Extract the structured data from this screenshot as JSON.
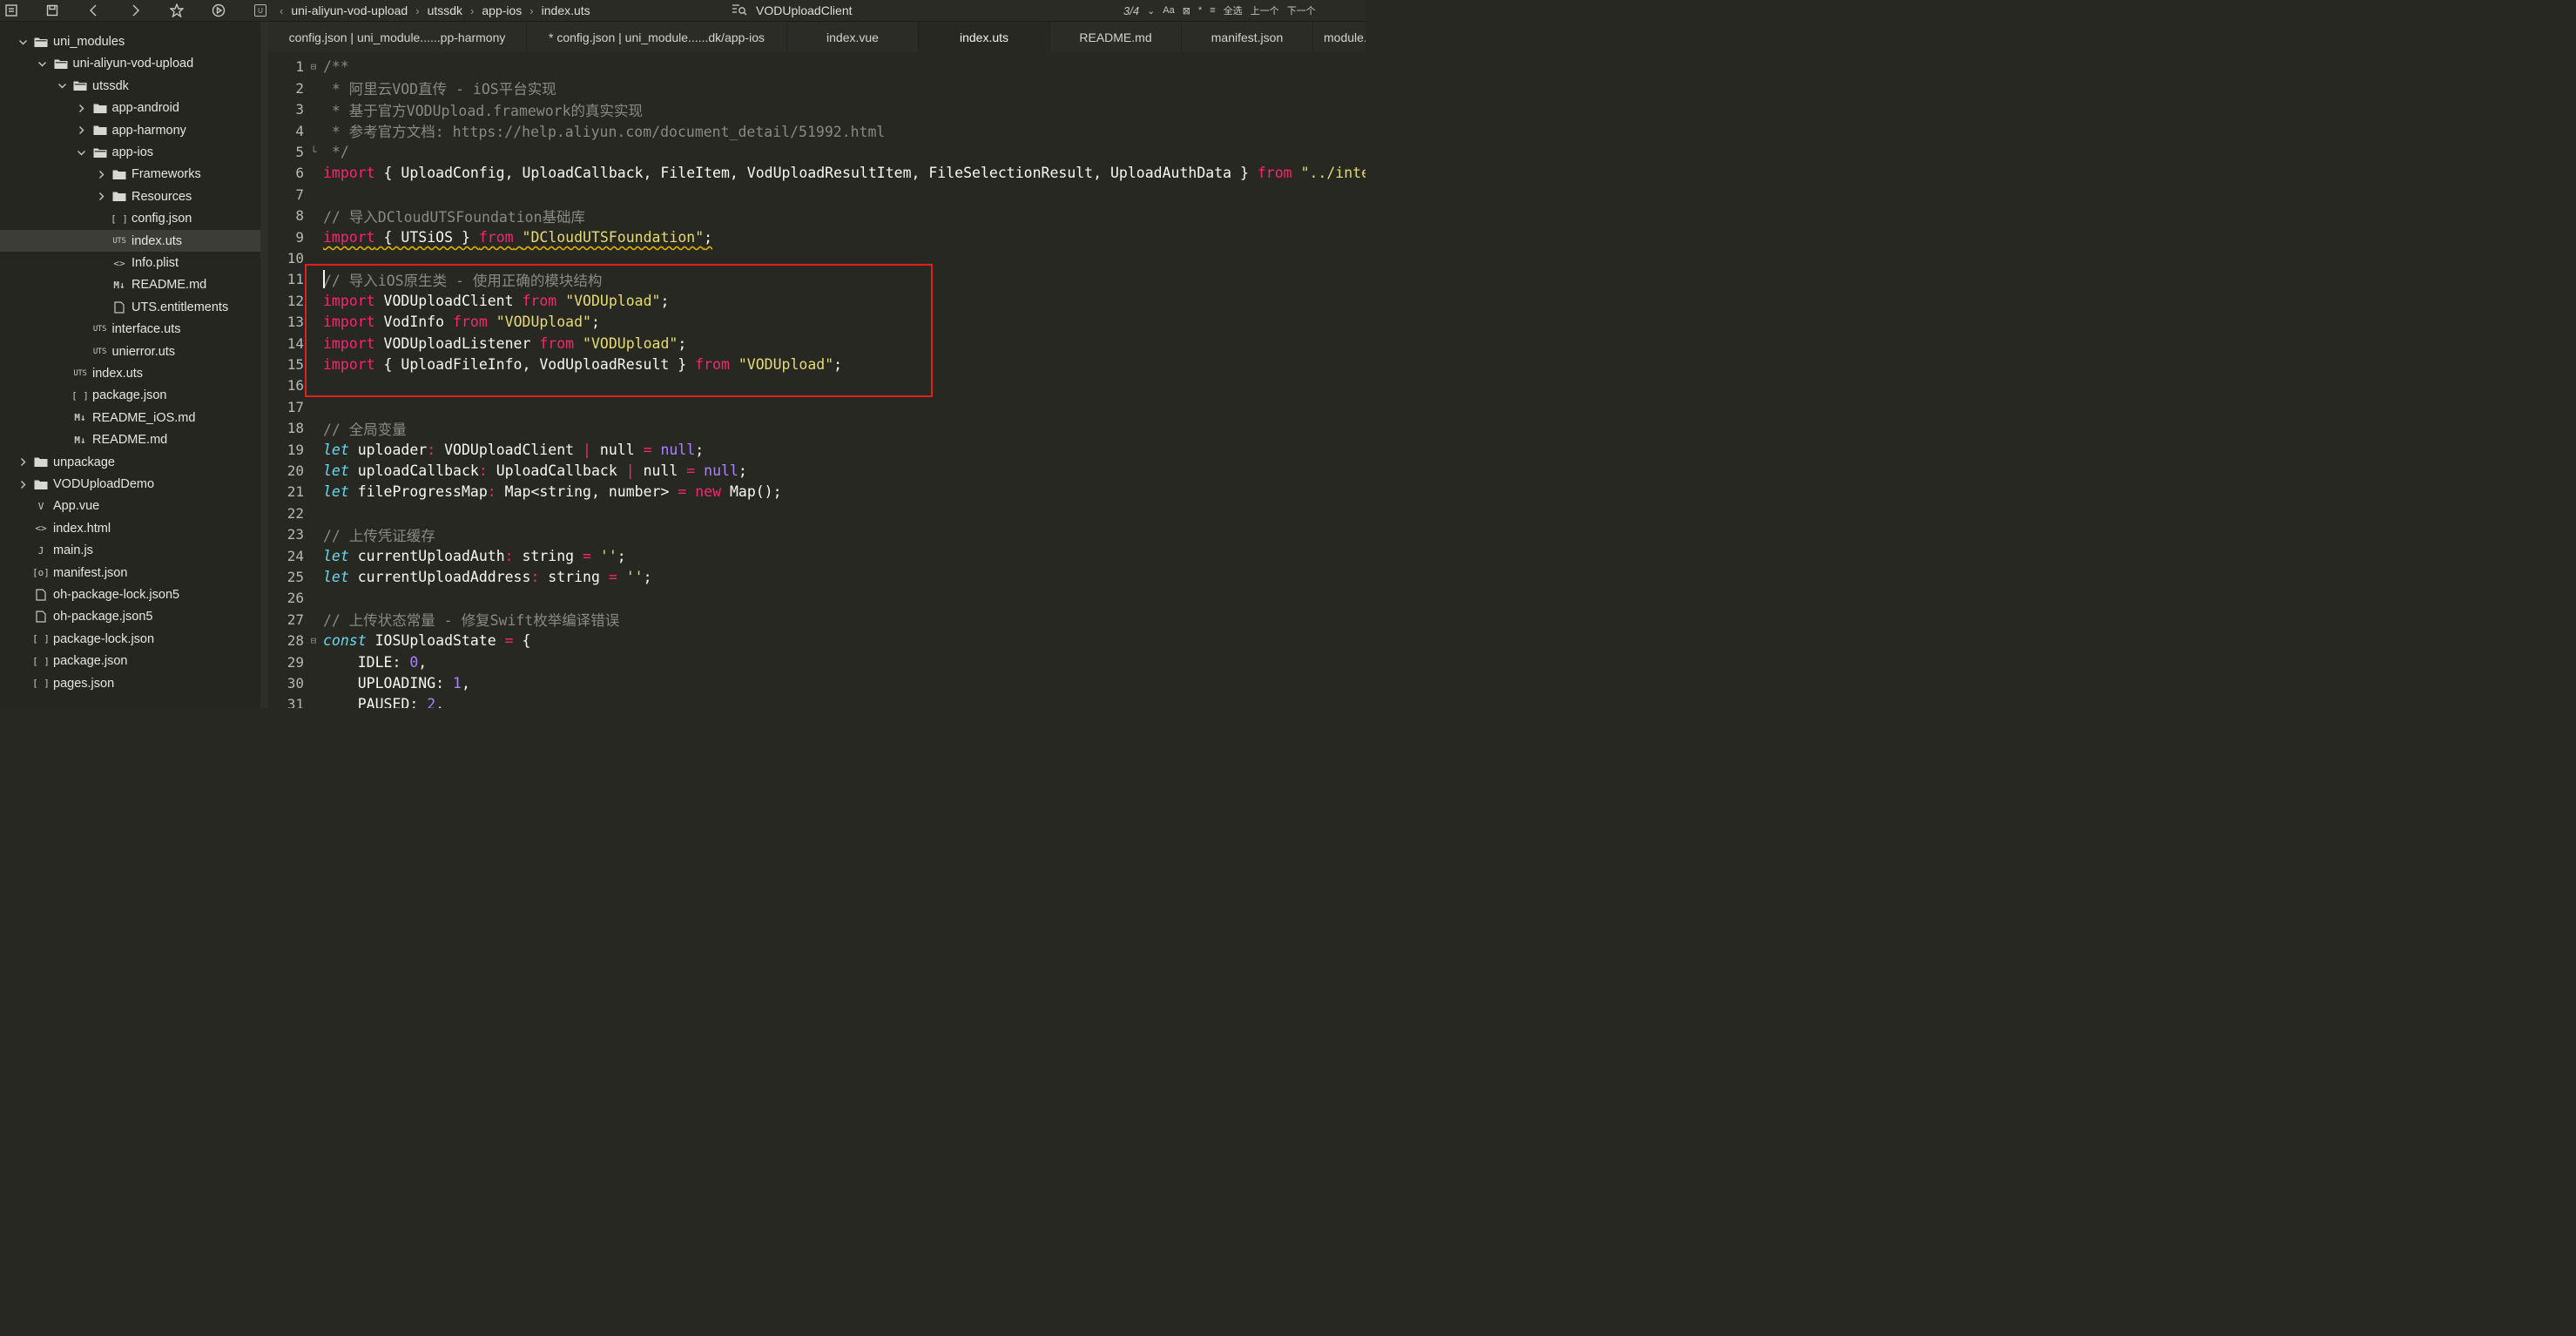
{
  "topbar": {
    "breadcrumbs": [
      "uni-aliyun-vod-upload",
      "utssdk",
      "app-ios",
      "index.uts"
    ],
    "symbol_name": "VODUploadClient",
    "match_count": "3/4",
    "right_controls": [
      "Aa",
      "全选",
      "上一个",
      "下一个"
    ]
  },
  "sidebar": {
    "items": [
      {
        "label": "uni_modules",
        "depth": 0,
        "kind": "folder",
        "expanded": true,
        "icon": "folder-icon"
      },
      {
        "label": "uni-aliyun-vod-upload",
        "depth": 1,
        "kind": "folder",
        "expanded": true,
        "icon": "folder-icon"
      },
      {
        "label": "utssdk",
        "depth": 2,
        "kind": "folder",
        "expanded": true,
        "icon": "folder-icon"
      },
      {
        "label": "app-android",
        "depth": 3,
        "kind": "folder",
        "expanded": false,
        "icon": "folder-icon"
      },
      {
        "label": "app-harmony",
        "depth": 3,
        "kind": "folder",
        "expanded": false,
        "icon": "folder-icon"
      },
      {
        "label": "app-ios",
        "depth": 3,
        "kind": "folder",
        "expanded": true,
        "icon": "folder-icon"
      },
      {
        "label": "Frameworks",
        "depth": 4,
        "kind": "folder",
        "expanded": false,
        "icon": "folder-icon"
      },
      {
        "label": "Resources",
        "depth": 4,
        "kind": "folder",
        "expanded": false,
        "icon": "folder-icon"
      },
      {
        "label": "config.json",
        "depth": 4,
        "kind": "file",
        "icon": "json-icon",
        "glyph": "[ ]"
      },
      {
        "label": "index.uts",
        "depth": 4,
        "kind": "file",
        "icon": "uts-icon",
        "glyph": "UTS",
        "selected": true
      },
      {
        "label": "Info.plist",
        "depth": 4,
        "kind": "file",
        "icon": "code-icon",
        "glyph": "<>"
      },
      {
        "label": "README.md",
        "depth": 4,
        "kind": "file",
        "icon": "markdown-icon",
        "glyph": "M↓"
      },
      {
        "label": "UTS.entitlements",
        "depth": 4,
        "kind": "file",
        "icon": "file-icon"
      },
      {
        "label": "interface.uts",
        "depth": 3,
        "kind": "file",
        "icon": "uts-icon",
        "glyph": "UTS"
      },
      {
        "label": "unierror.uts",
        "depth": 3,
        "kind": "file",
        "icon": "uts-icon",
        "glyph": "UTS"
      },
      {
        "label": "index.uts",
        "depth": 2,
        "kind": "file",
        "icon": "uts-icon",
        "glyph": "UTS"
      },
      {
        "label": "package.json",
        "depth": 2,
        "kind": "file",
        "icon": "json-icon",
        "glyph": "[ ]"
      },
      {
        "label": "README_iOS.md",
        "depth": 2,
        "kind": "file",
        "icon": "markdown-icon",
        "glyph": "M↓"
      },
      {
        "label": "README.md",
        "depth": 2,
        "kind": "file",
        "icon": "markdown-icon",
        "glyph": "M↓"
      },
      {
        "label": "unpackage",
        "depth": 0,
        "kind": "folder",
        "expanded": false,
        "icon": "folder-icon"
      },
      {
        "label": "VODUploadDemo",
        "depth": 0,
        "kind": "folder",
        "expanded": false,
        "icon": "folder-icon"
      },
      {
        "label": "App.vue",
        "depth": 0,
        "kind": "file",
        "icon": "vue-icon",
        "glyph": "V"
      },
      {
        "label": "index.html",
        "depth": 0,
        "kind": "file",
        "icon": "code-icon",
        "glyph": "<>"
      },
      {
        "label": "main.js",
        "depth": 0,
        "kind": "file",
        "icon": "js-icon",
        "glyph": "J"
      },
      {
        "label": "manifest.json",
        "depth": 0,
        "kind": "file",
        "icon": "settings-file-icon",
        "glyph": "[o]"
      },
      {
        "label": "oh-package-lock.json5",
        "depth": 0,
        "kind": "file",
        "icon": "file-icon"
      },
      {
        "label": "oh-package.json5",
        "depth": 0,
        "kind": "file",
        "icon": "file-icon"
      },
      {
        "label": "package-lock.json",
        "depth": 0,
        "kind": "file",
        "icon": "json-icon",
        "glyph": "[ ]"
      },
      {
        "label": "package.json",
        "depth": 0,
        "kind": "file",
        "icon": "json-icon",
        "glyph": "[ ]"
      },
      {
        "label": "pages.json",
        "depth": 0,
        "kind": "file",
        "icon": "json-icon",
        "glyph": "[ ]"
      }
    ]
  },
  "tabs": [
    {
      "label": "config.json | uni_module......pp-harmony",
      "active": false
    },
    {
      "label": "* config.json | uni_module......dk/app-ios",
      "active": false
    },
    {
      "label": "index.vue",
      "active": false
    },
    {
      "label": "index.uts",
      "active": true
    },
    {
      "label": "README.md",
      "active": false
    },
    {
      "label": "manifest.json",
      "active": false
    },
    {
      "label": "module.m",
      "active": false
    }
  ],
  "editor": {
    "lines": [
      {
        "n": "1",
        "fold": "⊟",
        "tokens": [
          [
            "c",
            "/**"
          ]
        ]
      },
      {
        "n": "2",
        "tokens": [
          [
            "c",
            " * 阿里云VOD直传 - iOS平台实现"
          ]
        ]
      },
      {
        "n": "3",
        "tokens": [
          [
            "c",
            " * 基于官方VODUpload.framework的真实实现"
          ]
        ]
      },
      {
        "n": "4",
        "tokens": [
          [
            "c",
            " * 参考官方文档: https://help.aliyun.com/document_detail/51992.html"
          ]
        ]
      },
      {
        "n": "5",
        "fold": "└",
        "tokens": [
          [
            "c",
            " */"
          ]
        ]
      },
      {
        "n": "6",
        "tokens": [
          [
            "k",
            "import"
          ],
          [
            "p",
            " { UploadConfig, UploadCallback, FileItem, VodUploadResultItem, FileSelectionResult, UploadAuthData } "
          ],
          [
            "k",
            "from"
          ],
          [
            "p",
            " "
          ],
          [
            "s",
            "\"../interface.uts\""
          ],
          [
            "p",
            ";"
          ]
        ]
      },
      {
        "n": "7",
        "tokens": []
      },
      {
        "n": "8",
        "tokens": [
          [
            "c",
            "// 导入DCloudUTSFoundation基础库"
          ]
        ]
      },
      {
        "n": "9",
        "squiggle": true,
        "tokens": [
          [
            "k",
            "import"
          ],
          [
            "p",
            " { UTSiOS } "
          ],
          [
            "k",
            "from"
          ],
          [
            "p",
            " "
          ],
          [
            "s",
            "\"DCloudUTSFoundation\""
          ],
          [
            "p",
            ";"
          ]
        ]
      },
      {
        "n": "10",
        "tokens": []
      },
      {
        "n": "11",
        "tokens": [
          [
            "c",
            "// 导入iOS原生类 - 使用正确的模块结构"
          ]
        ]
      },
      {
        "n": "12",
        "tokens": [
          [
            "k",
            "import"
          ],
          [
            "p",
            " VODUploadClient "
          ],
          [
            "k",
            "from"
          ],
          [
            "p",
            " "
          ],
          [
            "s",
            "\"VODUpload\""
          ],
          [
            "p",
            ";"
          ]
        ]
      },
      {
        "n": "13",
        "tokens": [
          [
            "k",
            "import"
          ],
          [
            "p",
            " VodInfo "
          ],
          [
            "k",
            "from"
          ],
          [
            "p",
            " "
          ],
          [
            "s",
            "\"VODUpload\""
          ],
          [
            "p",
            ";"
          ]
        ]
      },
      {
        "n": "14",
        "tokens": [
          [
            "k",
            "import"
          ],
          [
            "p",
            " VODUploadListener "
          ],
          [
            "k",
            "from"
          ],
          [
            "p",
            " "
          ],
          [
            "s",
            "\"VODUpload\""
          ],
          [
            "p",
            ";"
          ]
        ]
      },
      {
        "n": "15",
        "tokens": [
          [
            "k",
            "import"
          ],
          [
            "p",
            " { UploadFileInfo, VodUploadResult } "
          ],
          [
            "k",
            "from"
          ],
          [
            "p",
            " "
          ],
          [
            "s",
            "\"VODUpload\""
          ],
          [
            "p",
            ";"
          ]
        ]
      },
      {
        "n": "16",
        "tokens": []
      },
      {
        "n": "17",
        "tokens": []
      },
      {
        "n": "18",
        "tokens": [
          [
            "c",
            "// 全局变量"
          ]
        ]
      },
      {
        "n": "19",
        "tokens": [
          [
            "i",
            "let"
          ],
          [
            "p",
            " uploader"
          ],
          [
            "k",
            ":"
          ],
          [
            "p",
            " VODUploadClient "
          ],
          [
            "k",
            "|"
          ],
          [
            "p",
            " null "
          ],
          [
            "k",
            "="
          ],
          [
            "p",
            " "
          ],
          [
            "n",
            "null"
          ],
          [
            "p",
            ";"
          ]
        ]
      },
      {
        "n": "20",
        "tokens": [
          [
            "i",
            "let"
          ],
          [
            "p",
            " uploadCallback"
          ],
          [
            "k",
            ":"
          ],
          [
            "p",
            " UploadCallback "
          ],
          [
            "k",
            "|"
          ],
          [
            "p",
            " null "
          ],
          [
            "k",
            "="
          ],
          [
            "p",
            " "
          ],
          [
            "n",
            "null"
          ],
          [
            "p",
            ";"
          ]
        ]
      },
      {
        "n": "21",
        "tokens": [
          [
            "i",
            "let"
          ],
          [
            "p",
            " fileProgressMap"
          ],
          [
            "k",
            ":"
          ],
          [
            "p",
            " Map<string, number> "
          ],
          [
            "k",
            "="
          ],
          [
            "p",
            " "
          ],
          [
            "k",
            "new"
          ],
          [
            "p",
            " Map();"
          ]
        ]
      },
      {
        "n": "22",
        "tokens": []
      },
      {
        "n": "23",
        "tokens": [
          [
            "c",
            "// 上传凭证缓存"
          ]
        ]
      },
      {
        "n": "24",
        "tokens": [
          [
            "i",
            "let"
          ],
          [
            "p",
            " currentUploadAuth"
          ],
          [
            "k",
            ":"
          ],
          [
            "p",
            " string "
          ],
          [
            "k",
            "="
          ],
          [
            "p",
            " "
          ],
          [
            "s",
            "''"
          ],
          [
            "p",
            ";"
          ]
        ]
      },
      {
        "n": "25",
        "tokens": [
          [
            "i",
            "let"
          ],
          [
            "p",
            " currentUploadAddress"
          ],
          [
            "k",
            ":"
          ],
          [
            "p",
            " string "
          ],
          [
            "k",
            "="
          ],
          [
            "p",
            " "
          ],
          [
            "s",
            "''"
          ],
          [
            "p",
            ";"
          ]
        ]
      },
      {
        "n": "26",
        "tokens": []
      },
      {
        "n": "27",
        "tokens": [
          [
            "c",
            "// 上传状态常量 - 修复Swift枚举编译错误"
          ]
        ]
      },
      {
        "n": "28",
        "fold": "⊟",
        "tokens": [
          [
            "i",
            "const"
          ],
          [
            "p",
            " IOSUploadState "
          ],
          [
            "k",
            "="
          ],
          [
            "p",
            " {"
          ]
        ]
      },
      {
        "n": "29",
        "tokens": [
          [
            "p",
            "    IDLE: "
          ],
          [
            "n",
            "0"
          ],
          [
            "p",
            ","
          ]
        ]
      },
      {
        "n": "30",
        "tokens": [
          [
            "p",
            "    UPLOADING: "
          ],
          [
            "n",
            "1"
          ],
          [
            "p",
            ","
          ]
        ]
      },
      {
        "n": "31",
        "tokens": [
          [
            "p",
            "    PAUSED: "
          ],
          [
            "n",
            "2"
          ],
          [
            "p",
            ","
          ]
        ]
      }
    ]
  },
  "colors": {
    "background": "#272822",
    "keyword": "#f92672",
    "string": "#e6db74",
    "comment": "#8a8a80",
    "number": "#ae81ff",
    "italic_keyword": "#66d9ef",
    "highlight_box": "#e0201e"
  }
}
